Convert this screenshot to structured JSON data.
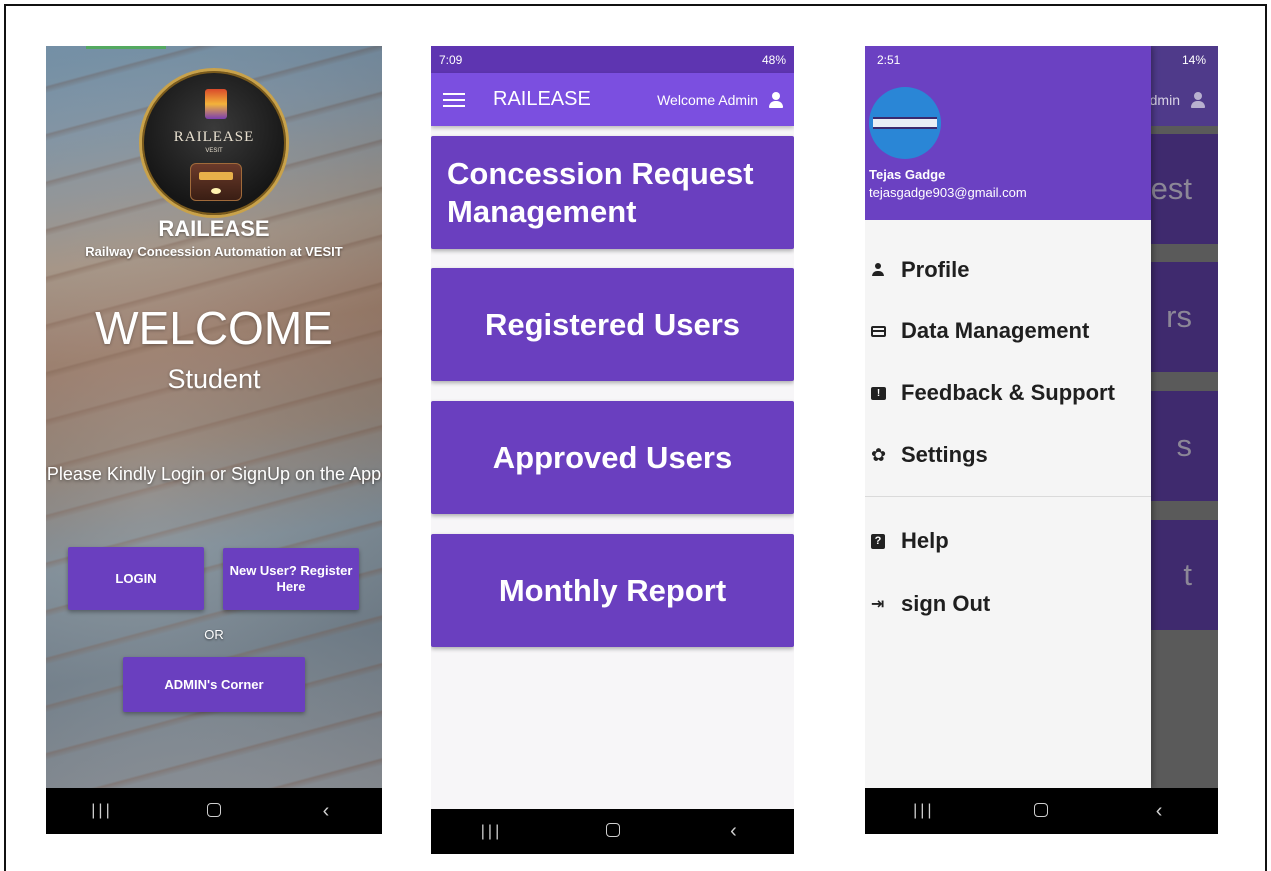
{
  "phone1": {
    "logo_text": "RAILEASE",
    "logo_sub": "VESIT",
    "title": "RAILEASE",
    "subtitle": "Railway Concession Automation at VESIT",
    "welcome": "WELCOME",
    "role": "Student",
    "prompt": "Please Kindly Login or SignUp on the App",
    "login_label": "LOGIN",
    "register_label": "New User? Register Here",
    "or_label": "OR",
    "admin_label": "ADMIN's Corner"
  },
  "phone2": {
    "status_time": "7:09",
    "status_right": "48%",
    "app_title": "RAILEASE",
    "welcome_text": "Welcome Admin",
    "cards": {
      "concession": "Concession Request Management",
      "registered": "Registered Users",
      "approved": "Approved Users",
      "monthly": "Monthly Report"
    }
  },
  "phone3": {
    "status_time": "2:51",
    "status_right": "14%",
    "behind_appbar_text": "dmin",
    "behind_cards": [
      "est",
      "rs",
      "s",
      "t"
    ],
    "user_name": "Tejas Gadge",
    "user_email": "tejasgadge903@gmail.com",
    "menu": {
      "profile": "Profile",
      "data": "Data Management",
      "feedback": "Feedback & Support",
      "settings": "Settings",
      "help": "Help",
      "signout": "sign Out"
    }
  },
  "nav": {
    "recent_icon": "recent-apps-icon",
    "home_icon": "home-icon",
    "back_icon": "back-icon"
  },
  "colors": {
    "primary": "#6a3fbf",
    "appbar": "#7b4fe0",
    "status": "#5e35b1"
  }
}
